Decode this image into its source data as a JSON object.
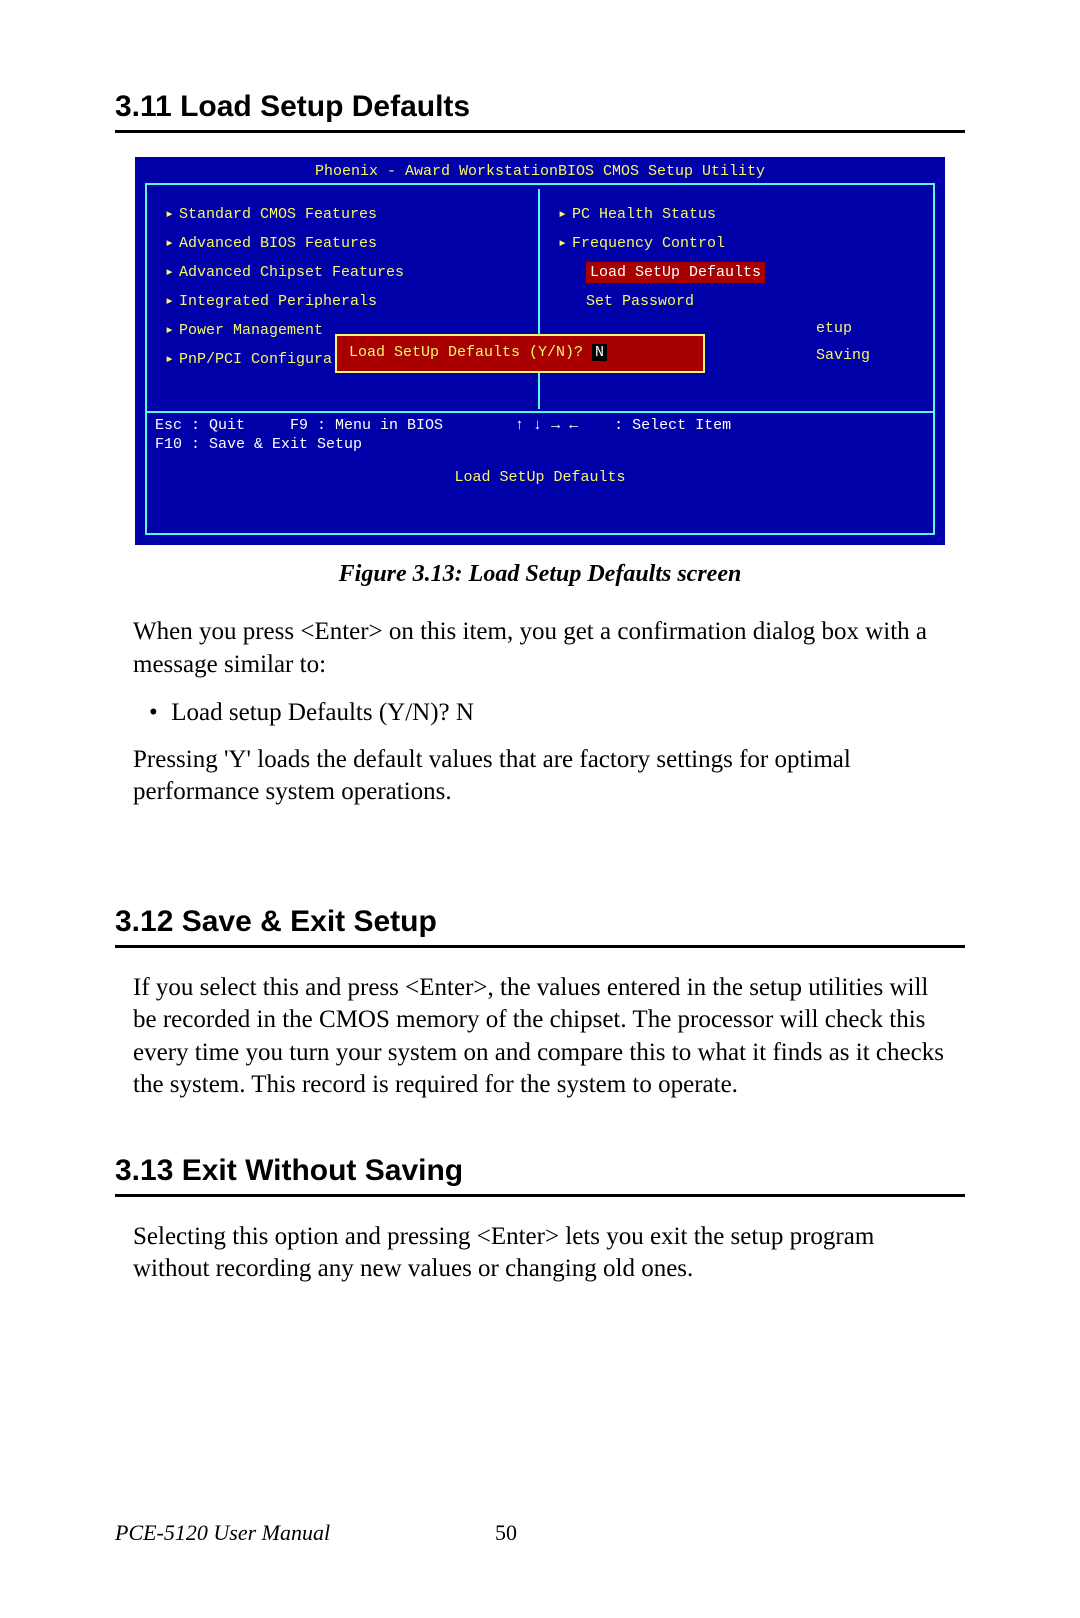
{
  "sections": {
    "s311": {
      "heading": "3.11  Load Setup Defaults"
    },
    "s312": {
      "heading": "3.12  Save & Exit Setup"
    },
    "s313": {
      "heading": "3.13  Exit Without Saving"
    }
  },
  "figure_caption": "Figure 3.13:  Load Setup Defaults screen",
  "paragraphs": {
    "p1": "When you press <Enter> on this item, you get a confirmation dialog box with a message similar to:",
    "bullet1": "Load setup Defaults (Y/N)? N",
    "p2": "Pressing 'Y' loads the default values that are factory settings for optimal performance system operations.",
    "p3": "If you select this and press <Enter>, the values entered in the setup utilities will be recorded in the CMOS memory of the chipset. The processor will check this every time you turn your system on and compare this to what it finds as it checks the system. This record is required for the system to operate.",
    "p4": "Selecting this option and pressing <Enter> lets you exit the setup program without recording any new values or changing old ones."
  },
  "footer": {
    "book": "PCE-5120 User Manual",
    "page": "50"
  },
  "bios": {
    "title": "Phoenix - Award WorkstationBIOS CMOS Setup Utility",
    "left_col": [
      "Standard CMOS Features",
      "Advanced BIOS Features",
      "Advanced Chipset Features",
      "Integrated Peripherals",
      "Power Management",
      "PnP/PCI Configura"
    ],
    "right_col": {
      "r1": "PC Health Status",
      "r2": "Frequency Control",
      "highlight": "Load SetUp Defaults",
      "r4": "Set Password",
      "r5_cut": "etup",
      "r6_cut": "Saving"
    },
    "hints_line1": "Esc : Quit     F9 : Menu in BIOS        ↑ ↓ → ←    : Select Item",
    "hints_line2": "F10 : Save & Exit Setup",
    "desc": "Load SetUp Defaults",
    "dialog_prompt": "Load SetUp Defaults (Y/N)? ",
    "dialog_answer": "N"
  }
}
